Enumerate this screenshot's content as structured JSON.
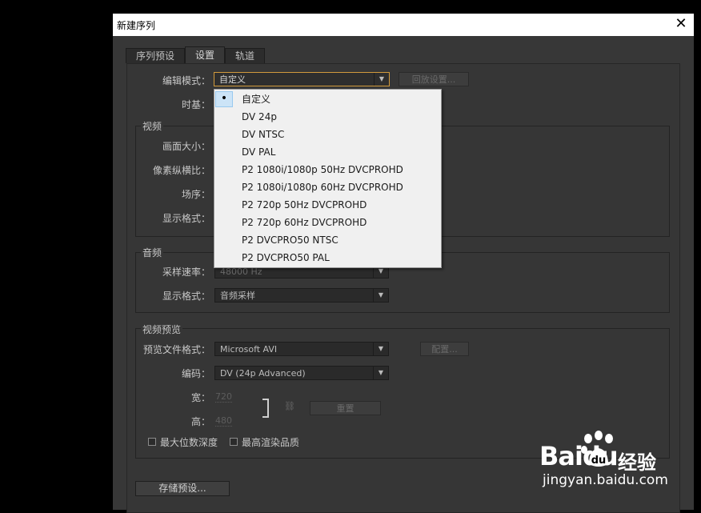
{
  "dialog": {
    "title": "新建序列",
    "close_glyph": "✕"
  },
  "tabs": [
    {
      "label": "序列预设",
      "active": false
    },
    {
      "label": "设置",
      "active": true
    },
    {
      "label": "轨道",
      "active": false
    }
  ],
  "settings": {
    "edit_mode_label": "编辑模式：",
    "edit_mode_value": "自定义",
    "playback_settings_button": "回放设置...",
    "timebase_label": "时基："
  },
  "video": {
    "group_title": "视频",
    "frame_size_label": "画面大小：",
    "pixel_aspect_label": "像素纵横比：",
    "field_order_label": "场序：",
    "display_format_label": "显示格式："
  },
  "audio": {
    "group_title": "音频",
    "sample_rate_label": "采样速率：",
    "sample_rate_value": "48000 Hz",
    "display_format_label": "显示格式：",
    "display_format_value": "音频采样"
  },
  "video_preview": {
    "group_title": "视频预览",
    "file_format_label": "预览文件格式：",
    "file_format_value": "Microsoft AVI",
    "configure_button": "配置...",
    "codec_label": "编码：",
    "codec_value": "DV (24p Advanced)",
    "width_label": "宽：",
    "width_value": "720",
    "height_label": "高：",
    "height_value": "480",
    "reset_button": "重置",
    "max_bit_depth_label": "最大位数深度",
    "max_render_quality_label": "最高渲染品质"
  },
  "save_preset_button": "存储预设...",
  "menu": {
    "selected_index": 0,
    "selected_mark": "•",
    "items": [
      "自定义",
      "DV 24p",
      "DV NTSC",
      "DV PAL",
      "P2 1080i/1080p 50Hz DVCPROHD",
      "P2 1080i/1080p 60Hz DVCPROHD",
      "P2 720p 50Hz DVCPROHD",
      "P2 720p 60Hz DVCPROHD",
      "P2 DVCPRO50 NTSC",
      "P2 DVCPRO50 PAL"
    ]
  },
  "icons": {
    "dropdown_arrow": "▼",
    "chain_link": "⛓"
  },
  "watermark": {
    "brand": "Baidu",
    "product": "经验",
    "url": "jingyan.baidu.com"
  },
  "colors": {
    "focus_border": "#d19a3c",
    "menu_highlight": "#cce4f7"
  }
}
